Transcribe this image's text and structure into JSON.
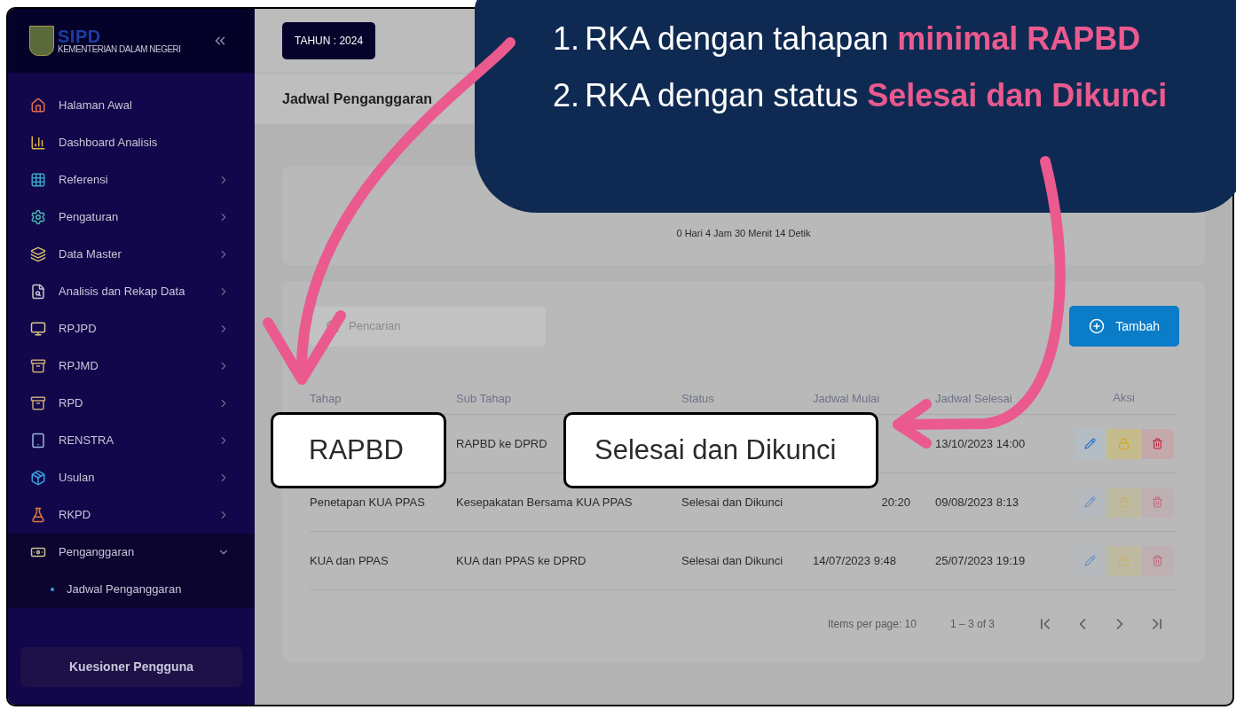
{
  "header": {
    "year_badge": "TAHUN : 2024"
  },
  "sidebar": {
    "logo_title": "SIPD",
    "logo_subtitle": "KEMENTERIAN DALAM NEGERI",
    "items": [
      {
        "label": "Halaman Awal",
        "kind": "home",
        "expandable": false,
        "expanded": false
      },
      {
        "label": "Dashboard Analisis",
        "kind": "chart",
        "expandable": false,
        "expanded": false
      },
      {
        "label": "Referensi",
        "kind": "grid",
        "expandable": true,
        "expanded": false
      },
      {
        "label": "Pengaturan",
        "kind": "gear",
        "expandable": true,
        "expanded": false
      },
      {
        "label": "Data Master",
        "kind": "stack",
        "expandable": true,
        "expanded": false
      },
      {
        "label": "Analisis dan Rekap Data",
        "kind": "doc",
        "expandable": true,
        "expanded": false
      },
      {
        "label": "RPJPD",
        "kind": "monitor",
        "expandable": true,
        "expanded": false
      },
      {
        "label": "RPJMD",
        "kind": "drawer",
        "expandable": true,
        "expanded": false
      },
      {
        "label": "RPD",
        "kind": "drawer",
        "expandable": true,
        "expanded": false
      },
      {
        "label": "RENSTRA",
        "kind": "tablet",
        "expandable": true,
        "expanded": false
      },
      {
        "label": "Usulan",
        "kind": "box",
        "expandable": true,
        "expanded": false
      },
      {
        "label": "RKPD",
        "kind": "lab",
        "expandable": true,
        "expanded": false
      },
      {
        "label": "Penganggaran",
        "kind": "money",
        "expandable": true,
        "expanded": true,
        "children": [
          {
            "label": "Jadwal Penganggaran"
          }
        ]
      }
    ],
    "footer_button": "Kuesioner Pengguna"
  },
  "page_title": "Jadwal Penganggaran",
  "countdown": "0 Hari 4 Jam 30 Menit 14 Detik",
  "search": {
    "placeholder": "Pencarian"
  },
  "add_button": "Tambah",
  "table": {
    "columns": [
      "Tahap",
      "Sub Tahap",
      "Status",
      "Jadwal Mulai",
      "Jadwal Selesai",
      "Aksi"
    ],
    "rows": [
      {
        "cells": [
          null,
          "RAPBD ke DPRD",
          null,
          null,
          "13/10/2023 14:00"
        ],
        "actions_enabled": true
      },
      {
        "cells": [
          "Penetapan KUA PPAS",
          "Kesepakatan Bersama KUA PPAS",
          "Selesai dan Dikunci",
          "20:20",
          "09/08/2023 8:13"
        ],
        "actions_enabled": false
      },
      {
        "cells": [
          "KUA dan PPAS",
          "KUA dan PPAS ke DPRD",
          "Selesai dan Dikunci",
          "14/07/2023 9:48",
          "25/07/2023 19:19"
        ],
        "actions_enabled": false
      }
    ]
  },
  "pagination": {
    "items_per_page": "Items per page: 10",
    "range": "1 – 3 of 3"
  },
  "note": {
    "items": [
      {
        "number": "1.",
        "text": "RKA dengan tahapan **minimal RAPBD**"
      },
      {
        "number": "2.",
        "text": "RKA dengan status **Selesai dan Dikunci**"
      }
    ]
  },
  "callouts": [
    {
      "text": "RAPBD"
    },
    {
      "text": "Selesai dan Dikunci"
    }
  ]
}
